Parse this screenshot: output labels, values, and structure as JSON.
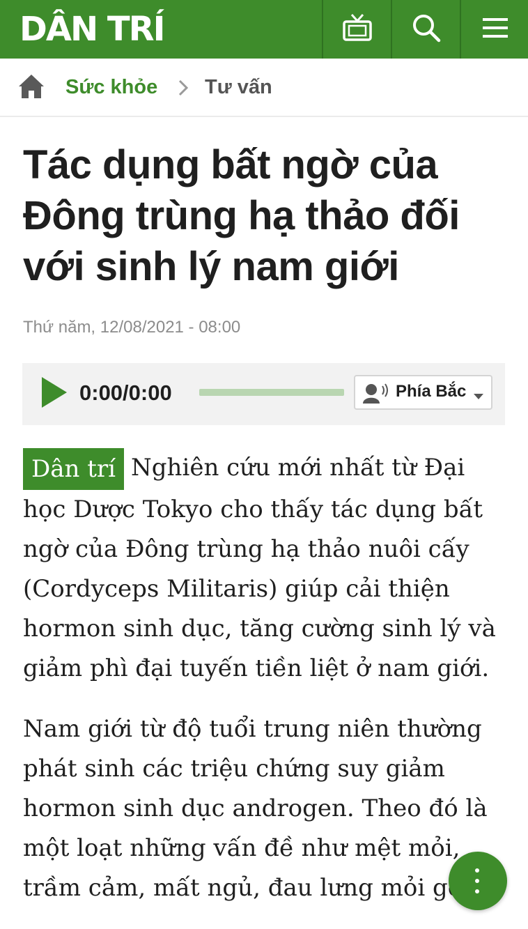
{
  "header": {
    "logo_text": "DÂN TRÍ",
    "colors": {
      "brand": "#3e8c2b",
      "brand_dark": "#2f7221"
    },
    "icons": [
      "tv-icon",
      "search-icon",
      "menu-icon"
    ]
  },
  "breadcrumb": {
    "home_icon": "home-icon",
    "items": [
      {
        "label": "Sức khỏe"
      },
      {
        "label": "Tư vấn"
      }
    ]
  },
  "article": {
    "title": "Tác dụng bất ngờ của Đông trùng hạ thảo đối với sinh lý nam giới",
    "date": "Thứ năm, 12/08/2021 - 08:00",
    "source_tag": "Dân trí",
    "lead": "Nghiên cứu mới nhất từ Đại học Dược Tokyo cho thấy tác dụng bất ngờ của Đông trùng hạ thảo nuôi cấy (Cordyceps Militaris) giúp cải thiện hormon sinh dục, tăng cường sinh lý và giảm phì đại tuyến tiền liệt ở nam giới.",
    "paragraph_1": "Nam giới từ độ tuổi trung niên thường phát sinh các triệu chứng suy giảm hormon sinh dục androgen. Theo đó là một loạt những vấn đề như mệt mỏi, trầm cảm, mất ngủ, đau lưng mỏi gối,"
  },
  "audio_player": {
    "time": "0:00/0:00",
    "progress": 0,
    "voice": "Phía Bắc"
  }
}
